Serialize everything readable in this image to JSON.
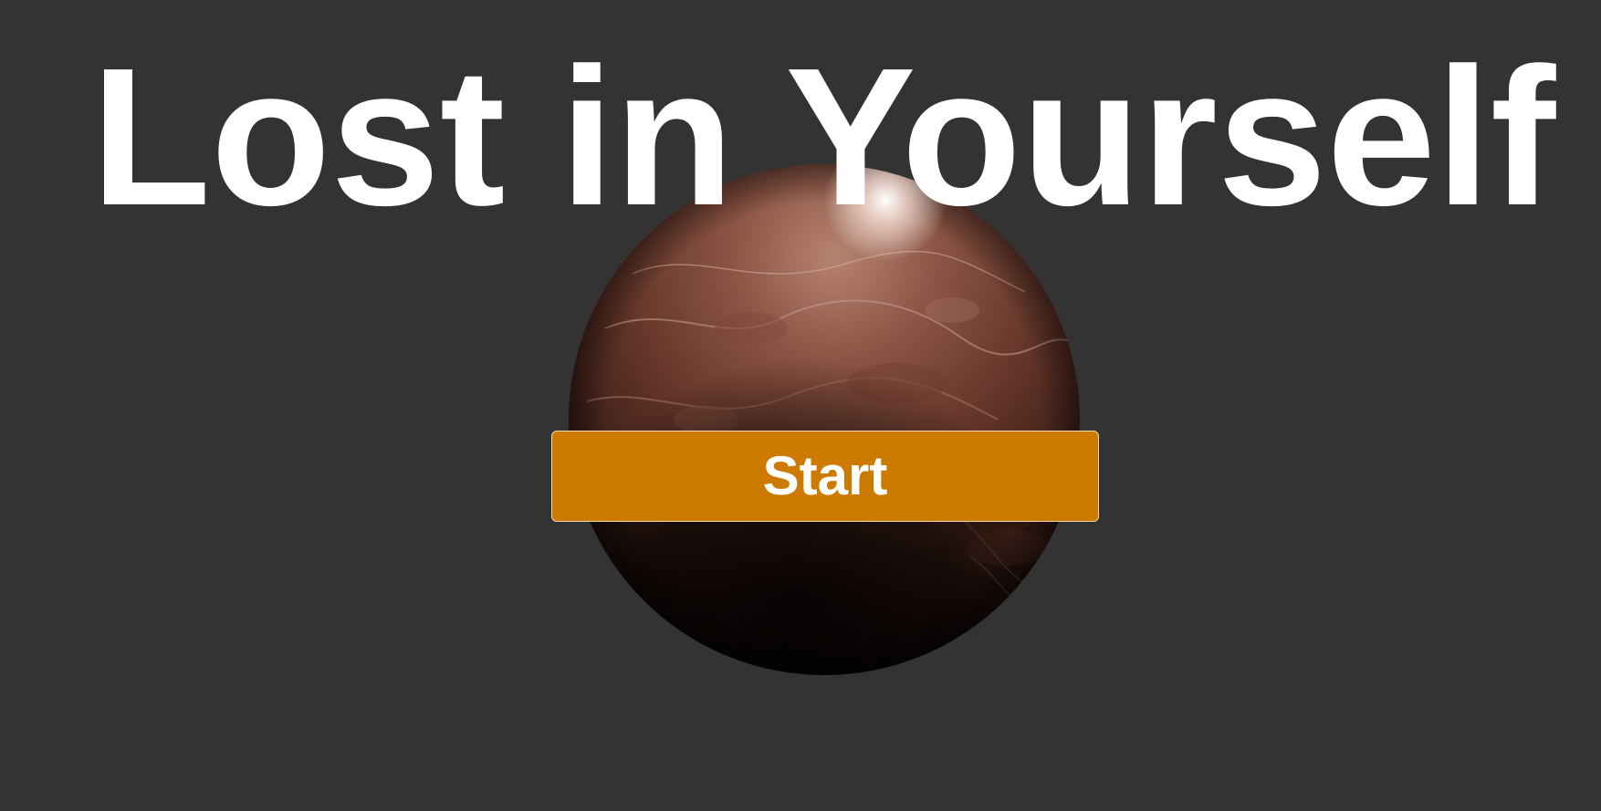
{
  "title": "Lost in Yourself",
  "start_button": {
    "label": "Start"
  },
  "colors": {
    "background": "#333333",
    "title": "#ffffff",
    "button": "#cc7a00",
    "button_text": "#ffffff",
    "planet": "#6e3a2c"
  },
  "planet": {
    "name": "planet-globe"
  }
}
